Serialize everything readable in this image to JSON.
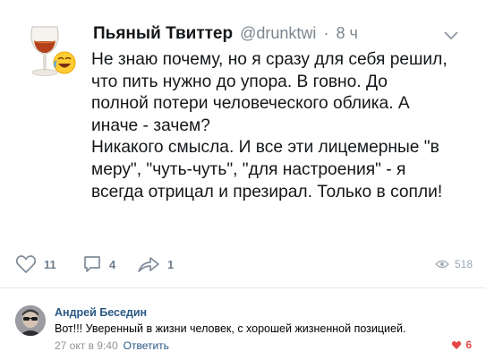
{
  "tweet": {
    "author_name": "Пьяный Твиттер",
    "handle": "@drunktwi",
    "separator": "·",
    "time": "8 ч",
    "avatar_icon": "cognac-glass-laughing-emoji-icon",
    "paragraph_1": "Не знаю почему, но я сразу для себя решил,\nчто пить нужно до упора. В говно. До\nполной потери человеческого облика. А\nиначе - зачем?",
    "paragraph_2": "Никакого смысла. И все эти лицемерные \"в\nмеру\", \"чуть-чуть\", \"для настроения\" - я\nвсегда отрицал и презирал. Только в сопли!"
  },
  "actions": {
    "likes": "11",
    "comments": "4",
    "reposts": "1",
    "views": "518"
  },
  "comment": {
    "author": "Андрей Беседин",
    "text": "Вот!!! Уверенный в жизни человек, с хорошей жизненной позицией.",
    "date": "27 окт в 9:40",
    "reply_label": "Ответить",
    "likes": "6"
  },
  "colors": {
    "link": "#2a5885",
    "muted": "#6f7d8b",
    "like_active": "#e64646"
  }
}
